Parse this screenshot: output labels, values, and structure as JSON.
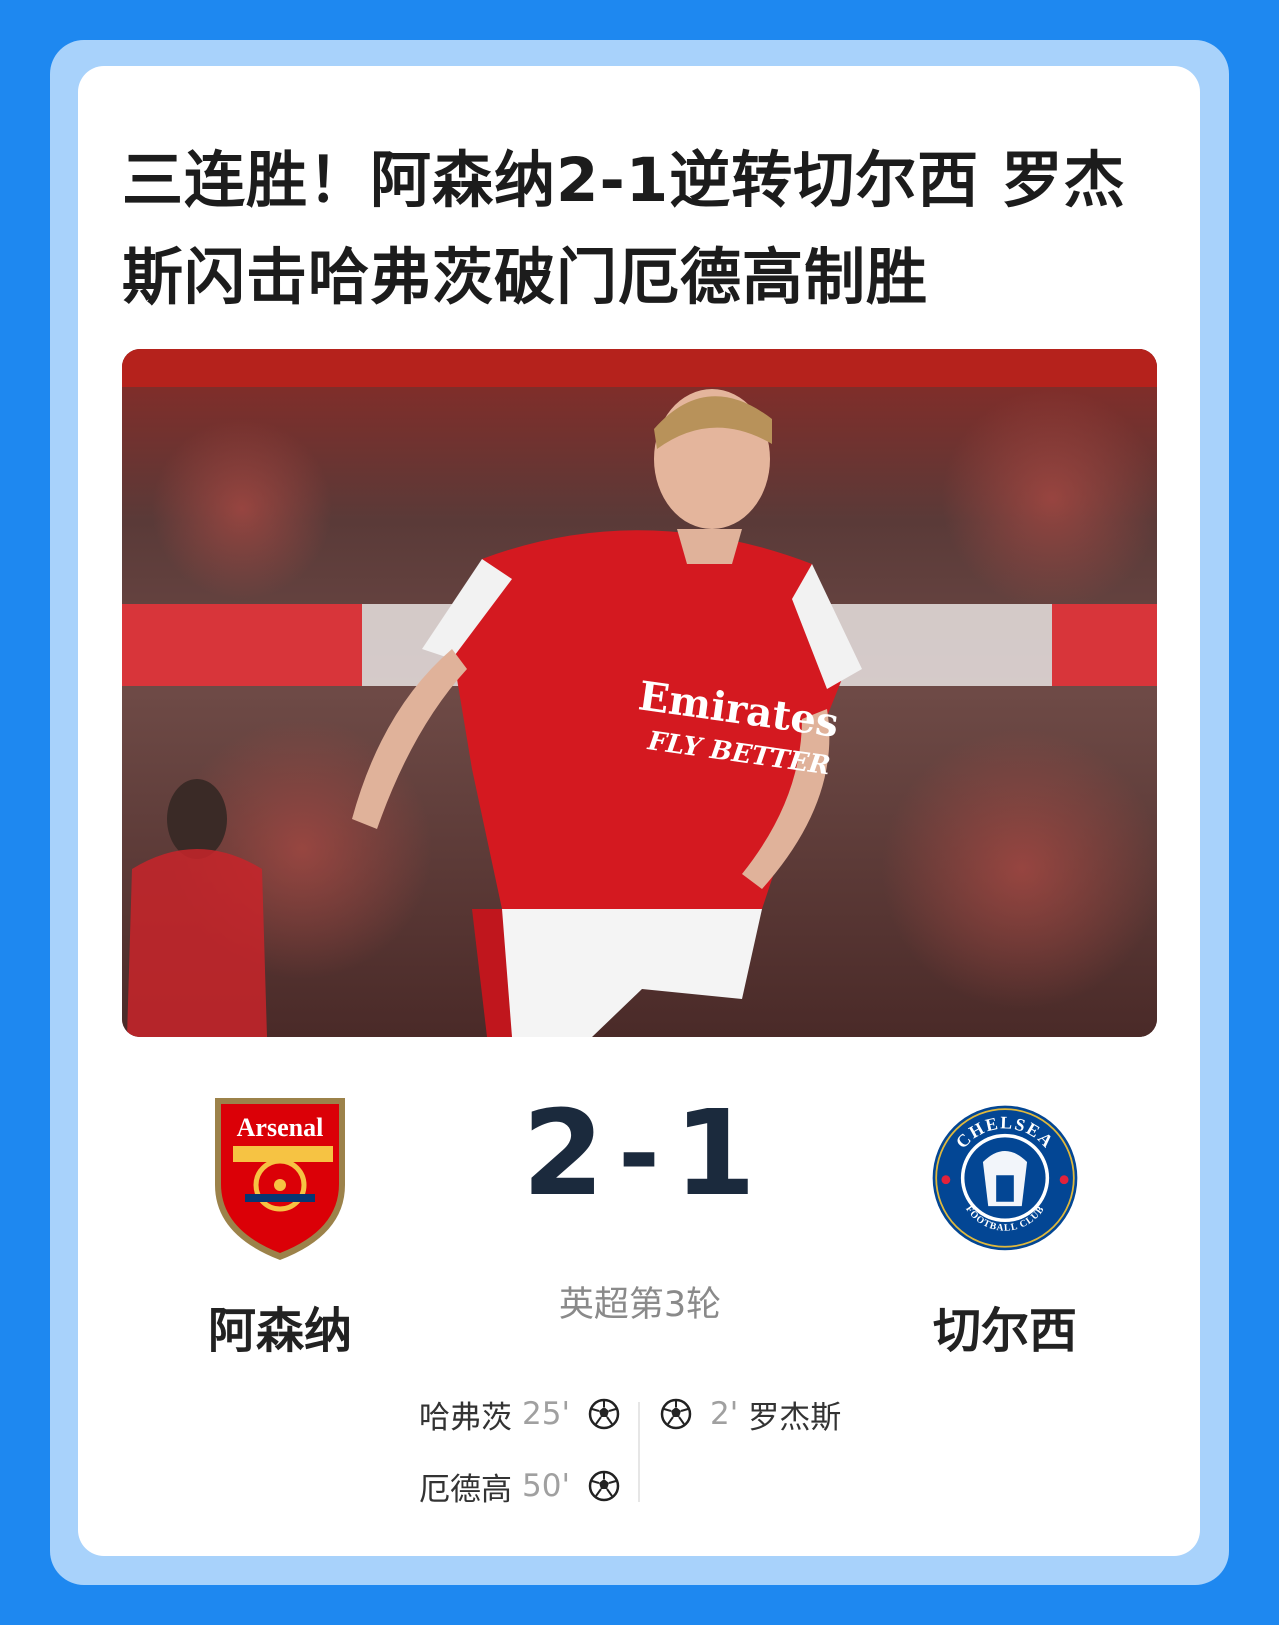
{
  "headline": "三连胜！阿森纳2-1逆转切尔西 罗杰斯闪击哈弗茨破门厄德高制胜",
  "photo": {
    "jersey_sponsor": "Emirates",
    "jersey_slogan": "FLY BETTER"
  },
  "match": {
    "home": {
      "name": "阿森纳",
      "crest_text": "Arsenal",
      "crest_icon": "arsenal-crest-icon"
    },
    "away": {
      "name": "切尔西",
      "crest_text_top": "CHELSEA",
      "crest_text_bottom": "FOOTBALL CLUB",
      "crest_icon": "chelsea-crest-icon"
    },
    "home_score": "2",
    "score_separator": "-",
    "away_score": "1",
    "competition": "英超第3轮"
  },
  "scorers": {
    "home": [
      {
        "player": "哈弗茨",
        "minute": "25'"
      },
      {
        "player": "厄德高",
        "minute": "50'"
      }
    ],
    "away": [
      {
        "player": "罗杰斯",
        "minute": "2'"
      }
    ]
  },
  "colors": {
    "page_background": "#1e88f0",
    "frame": "#a8d2fb",
    "score_text": "#1b2a3d",
    "arsenal_red": "#db0007",
    "chelsea_blue": "#034694"
  }
}
